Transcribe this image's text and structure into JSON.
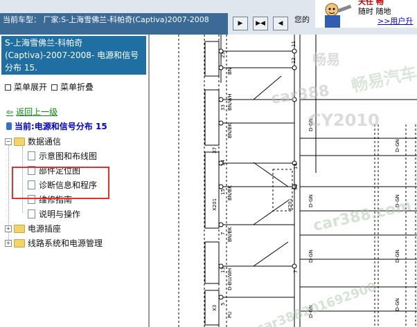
{
  "header": {
    "model_label": "当前车型：",
    "model_value": "厂家:S-上海雪佛兰-科帕奇(Captiva)2007-2008",
    "ticker_text": "您的"
  },
  "promo": {
    "line1": "天任 畅",
    "line2": "随时 随地",
    "line3": ">>用户升"
  },
  "left_panel": {
    "title": "S-上海雪佛兰-科帕奇(Captiva)-2007-2008- 电源和信号分布 15.",
    "expand_label": "菜单展开",
    "collapse_label": "菜单折叠",
    "back_label": "返回上一级",
    "current_label": "当前:电源和信号分布 15"
  },
  "tree": [
    {
      "label": "数据通信",
      "kind": "folder",
      "state": "-"
    },
    {
      "label": "示意图和布线图",
      "kind": "doc"
    },
    {
      "label": "部件定位图",
      "kind": "doc"
    },
    {
      "label": "诊断信息和程序",
      "kind": "doc"
    },
    {
      "label": "维修指南",
      "kind": "doc"
    },
    {
      "label": "说明与操作",
      "kind": "doc"
    },
    {
      "label": "电源插座",
      "kind": "folder",
      "state": "+"
    },
    {
      "label": "线路系统和电源管理",
      "kind": "folder",
      "state": "+"
    }
  ],
  "diagram": {
    "watermarks": [
      "畅易",
      "car388",
      "畅易汽车",
      "CY2010",
      "car388.com",
      "car388201692900"
    ],
    "wire_colors": [
      "BN",
      "BN/WH",
      "BN/BK",
      "D-BU/WH",
      "PU",
      "D-GN"
    ],
    "pin_numbers": [
      "11",
      "12",
      "13",
      "14",
      "15",
      "16",
      "22",
      "23",
      "33",
      "96",
      "7",
      "5",
      "6"
    ],
    "connectors": [
      "X7",
      "X3",
      "X201",
      "X4"
    ],
    "accent_color": "#e23030"
  }
}
